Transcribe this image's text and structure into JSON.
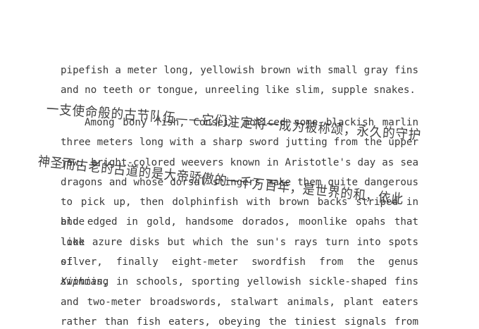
{
  "paragraph1": {
    "lines": [
      "pipefish a meter long, yellowish brown with small gray fins",
      "and no teeth or tongue, unreeling like slim, supple snakes."
    ]
  },
  "paragraph2": {
    "lines": [
      "Among bony fish, Conseil noticed some blackish marlin",
      "three meters long with a sharp sword jutting from the upper",
      "jaw, bright-colored weevers known in Aristotle's day as sea",
      "dragons and whose dorsal stingers make them quite dangerous",
      "to pick up, then dolphinfish with brown backs striped in blue",
      "and edged in gold, handsome dorados, moonlike opahs that look",
      "like azure disks but which the sun's rays turn into spots of",
      "silver, finally eight-meter swordfish from the genus ",
      "swimming in schools, sporting yellowish sickle-shaped fins",
      "and two-meter broadswords, stalwart animals, plant eaters",
      "rather than fish eaters, obeying the tiniest signals from"
    ],
    "genus": "Xiphias",
    "genus_suffix": ","
  },
  "handwriting": {
    "line1": "一支使命般的古节队伍——它们注定将一成为被称颂，永久的守护",
    "line2": "神圣而古老的古道的是大帝骄傲的一千万百年，是世界的和，依此"
  }
}
